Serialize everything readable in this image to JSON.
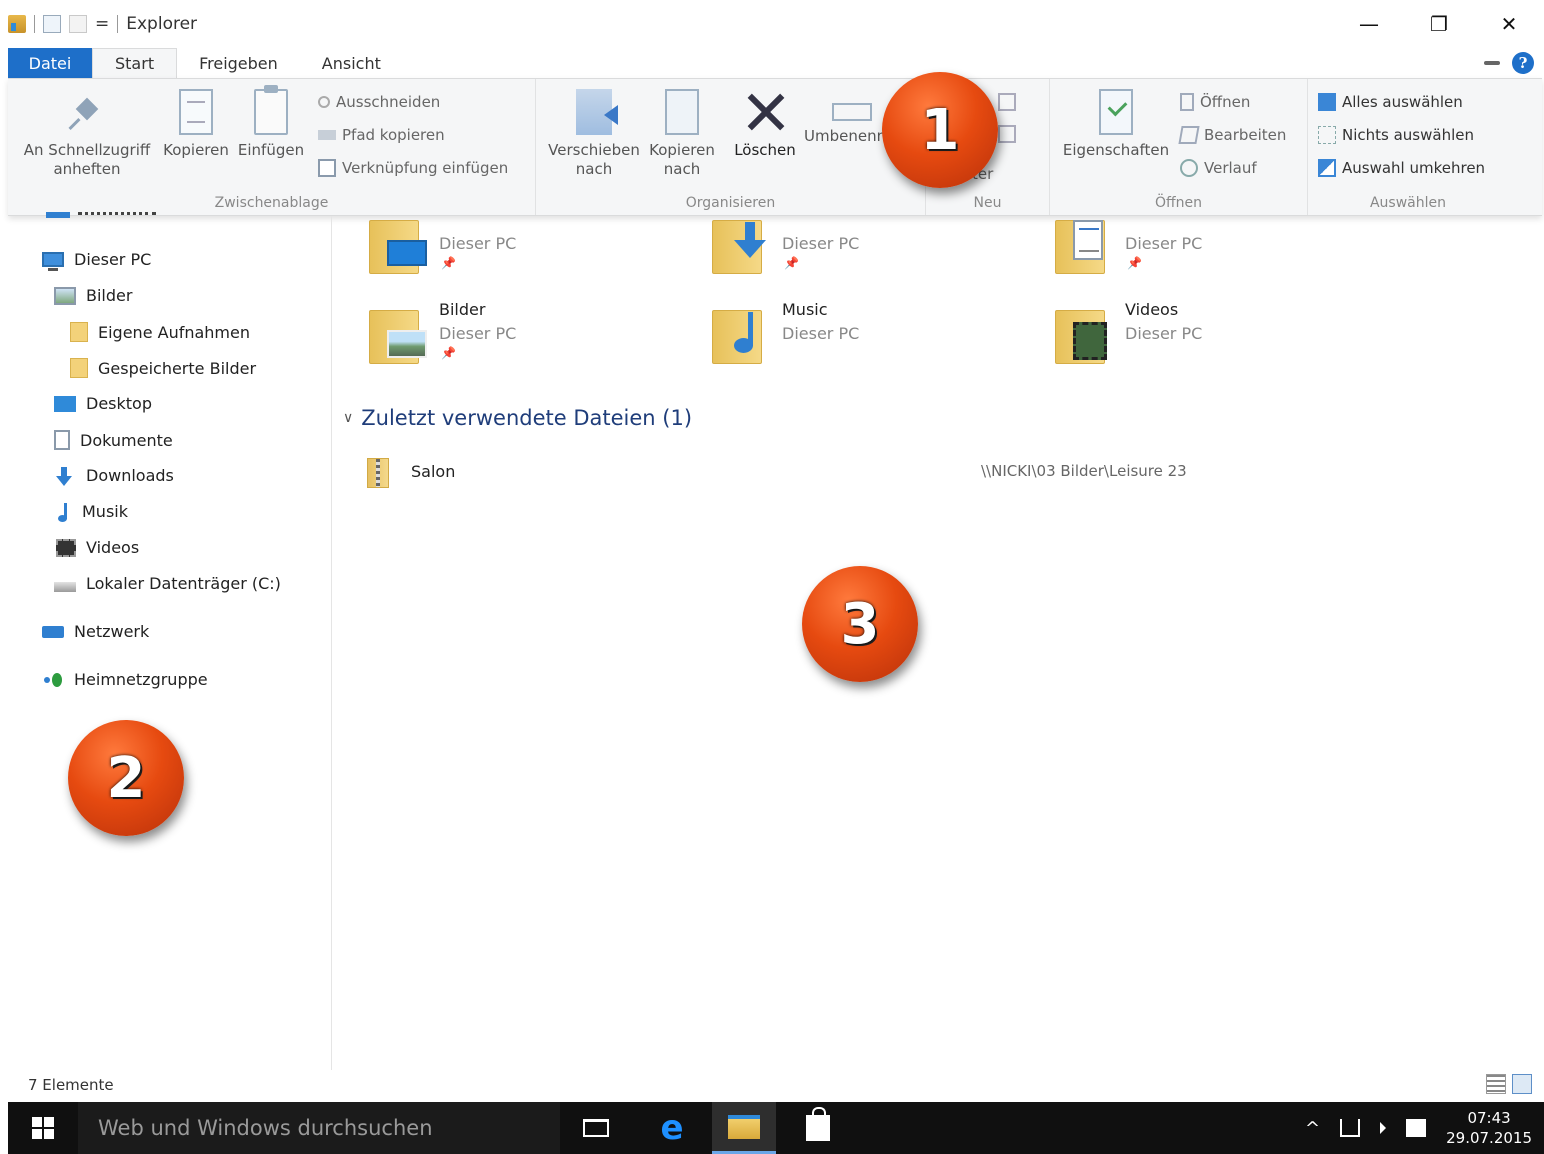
{
  "titlebar": {
    "title": "Explorer",
    "qat_dropdown": "=",
    "minimize": "—",
    "maximize": "❐",
    "close": "✕"
  },
  "tabs": [
    "Datei",
    "Start",
    "Freigeben",
    "Ansicht"
  ],
  "ribbon": {
    "help": "?",
    "clipboard": {
      "pin": "An Schnellzugriff anheften",
      "copy": "Kopieren",
      "paste": "Einfügen",
      "cut": "Ausschneiden",
      "copy_path": "Pfad kopieren",
      "paste_link": "Verknüpfung einfügen",
      "label": "Zwischenablage"
    },
    "organize": {
      "move_to": "Verschieben nach",
      "copy_to": "Kopieren nach",
      "delete": "Löschen",
      "rename": "Umbenennen",
      "label": "Organisieren"
    },
    "new": {
      "partial_text": "ter",
      "label": "Neu"
    },
    "open": {
      "properties": "Eigenschaften",
      "open": "Öffnen",
      "edit": "Bearbeiten",
      "history": "Verlauf",
      "label": "Öffnen"
    },
    "select": {
      "select_all": "Alles auswählen",
      "select_none": "Nichts auswählen",
      "invert": "Auswahl umkehren",
      "label": "Auswählen"
    }
  },
  "nav": {
    "this_pc": "Dieser PC",
    "pictures": "Bilder",
    "own_photos": "Eigene Aufnahmen",
    "saved_pictures": "Gespeicherte Bilder",
    "desktop": "Desktop",
    "documents": "Dokumente",
    "downloads": "Downloads",
    "music": "Musik",
    "videos": "Videos",
    "local_disk": "Lokaler Datenträger (C:)",
    "network": "Netzwerk",
    "homegroup": "Heimnetzgruppe"
  },
  "quick_access": [
    {
      "name": "",
      "sub": "Dieser PC",
      "icon": "desktop-folder-icon"
    },
    {
      "name": "",
      "sub": "Dieser PC",
      "icon": "downloads-folder-icon"
    },
    {
      "name": "",
      "sub": "Dieser PC",
      "icon": "documents-folder-icon"
    },
    {
      "name": "Bilder",
      "sub": "Dieser PC",
      "icon": "pictures-folder-icon"
    },
    {
      "name": "Music",
      "sub": "Dieser PC",
      "icon": "music-folder-icon"
    },
    {
      "name": "Videos",
      "sub": "Dieser PC",
      "icon": "videos-folder-icon"
    }
  ],
  "pin_glyph": "📌",
  "recent": {
    "header": "Zuletzt verwendete Dateien (1)",
    "chevron": "∨",
    "items": [
      {
        "name": "Salon",
        "path": "\\\\NICKI\\03 Bilder\\Leisure 23"
      }
    ]
  },
  "status": {
    "count": "7 Elemente"
  },
  "taskbar": {
    "search_placeholder": "Web und Windows durchsuchen",
    "tray_up": "^",
    "time": "07:43",
    "date": "29.07.2015"
  },
  "callouts": [
    "1",
    "2",
    "3"
  ],
  "colors": {
    "accent": "#1e6fc9",
    "callout": "#e64a10",
    "taskbar": "#101010"
  }
}
